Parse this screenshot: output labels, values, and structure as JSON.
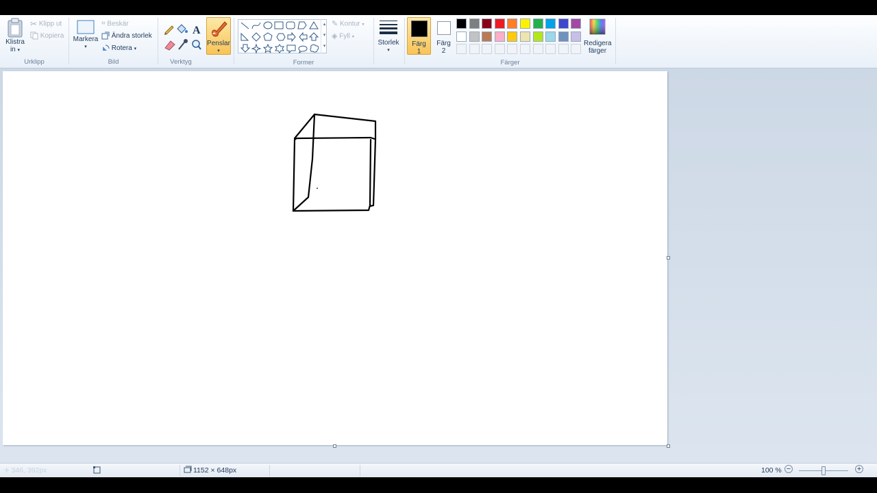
{
  "ribbon": {
    "clipboard": {
      "group_label": "Urklipp",
      "paste_label": "Klistra",
      "paste_label2": "in",
      "cut_label": "Klipp ut",
      "copy_label": "Kopiera"
    },
    "image": {
      "group_label": "Bild",
      "select_label": "Markera",
      "crop_label": "Beskär",
      "resize_label": "Ändra storlek",
      "rotate_label": "Rotera"
    },
    "tools": {
      "group_label": "Verktyg",
      "brushes_label": "Penslar"
    },
    "shapes": {
      "group_label": "Former",
      "outline_label": "Kontur",
      "fill_label": "Fyll"
    },
    "size": {
      "label": "Storlek"
    },
    "colors": {
      "group_label": "Färger",
      "color1_label": "Färg",
      "color1_num": "1",
      "color2_label": "Färg",
      "color2_num": "2",
      "edit_label": "Redigera",
      "edit_label2": "färger",
      "color1_value": "#000000",
      "color2_value": "#ffffff",
      "palette_row1": [
        "#000000",
        "#7f7f7f",
        "#880015",
        "#ed1c24",
        "#ff7f27",
        "#fff200",
        "#22b14c",
        "#00a2e8",
        "#3f48cc",
        "#a349a4"
      ],
      "palette_row2": [
        "#ffffff",
        "#c3c3c3",
        "#b97a57",
        "#ffaec9",
        "#ffc90e",
        "#efe4b0",
        "#b5e61d",
        "#99d9ea",
        "#7092be",
        "#c8bfe7"
      ]
    }
  },
  "statusbar": {
    "cursor_pos": "346, 392px",
    "canvas_size": "1152 × 648px",
    "zoom": "100 %"
  }
}
